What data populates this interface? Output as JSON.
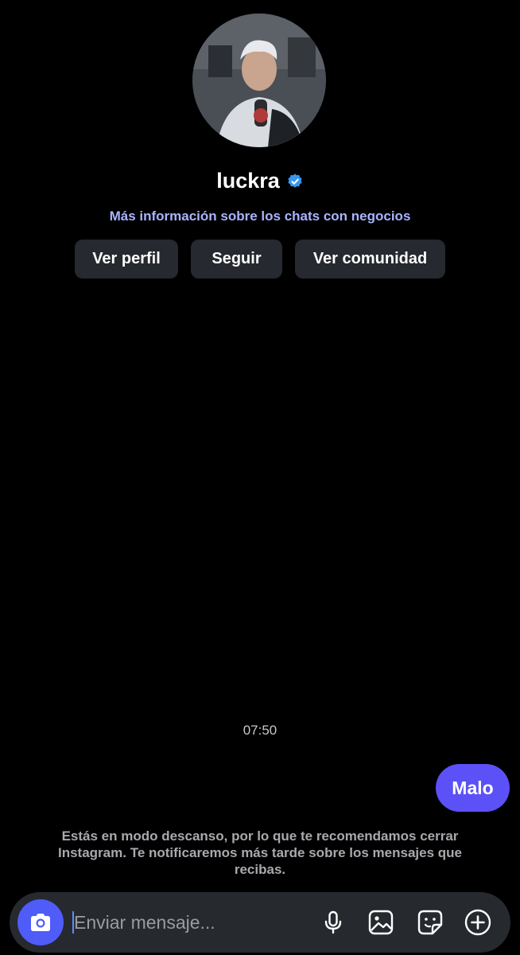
{
  "profile": {
    "username": "luckra",
    "info_link": "Más información sobre los chats con negocios",
    "verified": true
  },
  "actions": {
    "view_profile": "Ver perfil",
    "follow": "Seguir",
    "view_community": "Ver comunidad"
  },
  "chat": {
    "timestamp": "07:50",
    "messages": [
      {
        "from": "me",
        "text": "Malo"
      }
    ],
    "rest_mode_notice": "Estás en modo descanso, por lo que te recomendamos cerrar Instagram. Te notificaremos más tarde sobre los mensajes que recibas."
  },
  "composer": {
    "placeholder": "Enviar mensaje...",
    "value": "",
    "icons": [
      "camera-icon",
      "microphone-icon",
      "gallery-icon",
      "sticker-icon",
      "plus-icon"
    ]
  },
  "colors": {
    "background": "#000000",
    "accent": "#5b51f6",
    "link": "#a9b4ff",
    "verified": "#3897f0",
    "button_bg": "#26292f"
  }
}
